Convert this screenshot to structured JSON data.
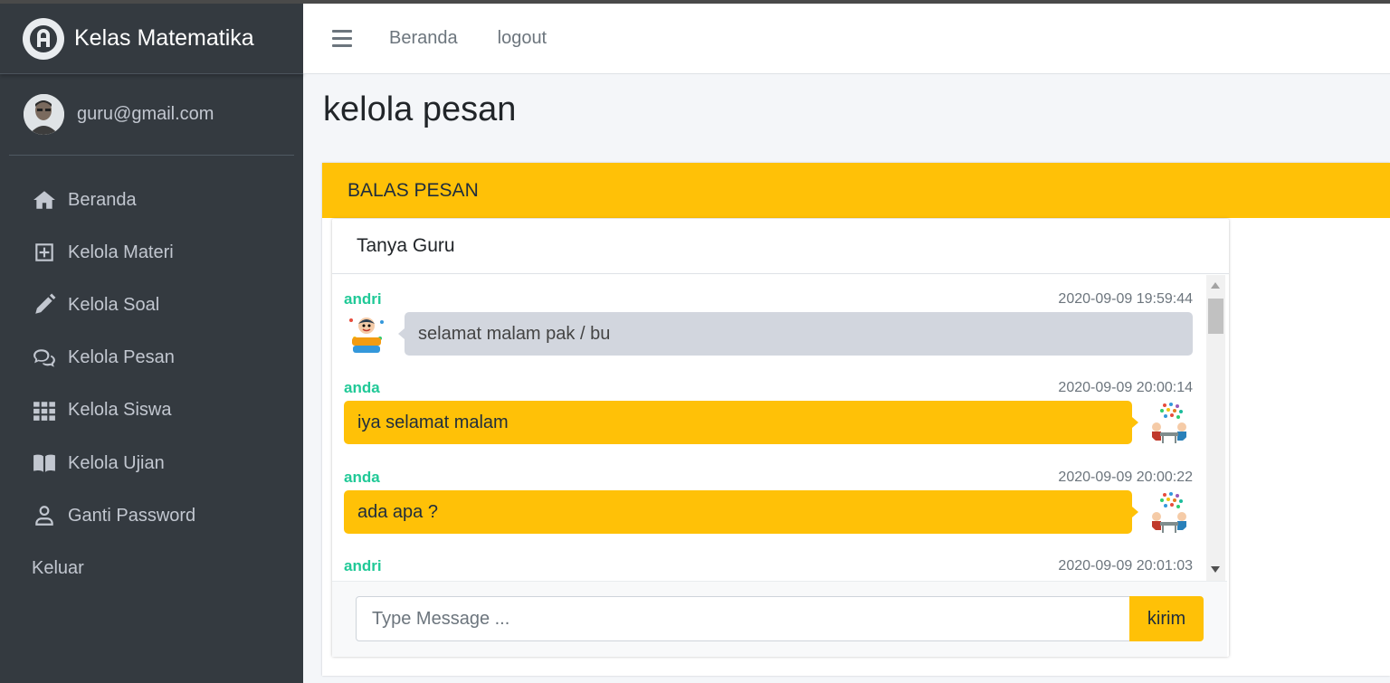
{
  "app": {
    "brand": "Kelas Matematika",
    "brand_icon": "app-logo-icon"
  },
  "user": {
    "email": "guru@gmail.com",
    "avatar_icon": "user-avatar"
  },
  "sidebar": {
    "items": [
      {
        "label": "Beranda",
        "icon": "home-icon"
      },
      {
        "label": "Kelola Materi",
        "icon": "plus-square-icon"
      },
      {
        "label": "Kelola Soal",
        "icon": "pencil-icon"
      },
      {
        "label": "Kelola Pesan",
        "icon": "comments-icon"
      },
      {
        "label": "Kelola Siswa",
        "icon": "grid-icon"
      },
      {
        "label": "Kelola Ujian",
        "icon": "book-icon"
      },
      {
        "label": "Ganti Password",
        "icon": "user-icon"
      },
      {
        "label": "Keluar",
        "icon": ""
      }
    ]
  },
  "navbar": {
    "links": [
      "Beranda",
      "logout"
    ]
  },
  "page": {
    "title": "kelola pesan",
    "card_title": "BALAS PESAN"
  },
  "chat": {
    "title": "Tanya Guru",
    "messages": [
      {
        "name": "andri",
        "time": "2020-09-09 19:59:44",
        "text": "selamat malam pak / bu",
        "side": "left"
      },
      {
        "name": "anda",
        "time": "2020-09-09 20:00:14",
        "text": "iya selamat malam",
        "side": "right"
      },
      {
        "name": "anda",
        "time": "2020-09-09 20:00:22",
        "text": "ada apa ?",
        "side": "right"
      },
      {
        "name": "andri",
        "time": "2020-09-09 20:01:03",
        "text": "",
        "side": "left"
      }
    ],
    "input_placeholder": "Type Message ...",
    "send_label": "kirim"
  },
  "colors": {
    "sidebar_bg": "#343a40",
    "accent": "#ffc107",
    "name_green": "#20c997"
  }
}
